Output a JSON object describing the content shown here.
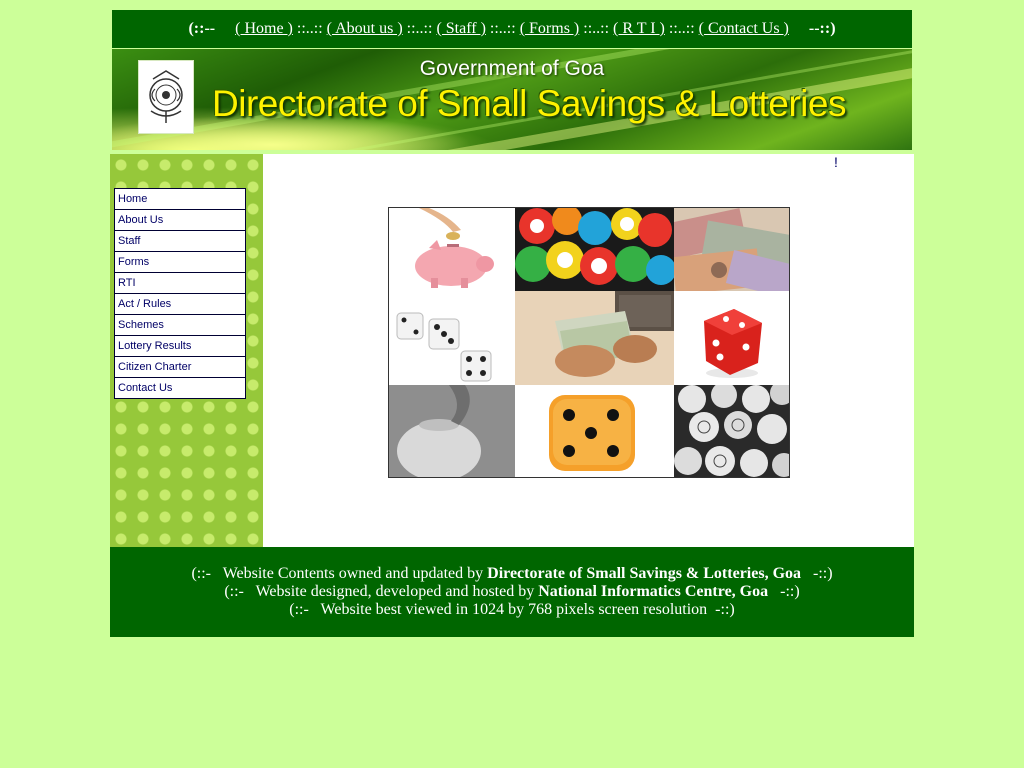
{
  "topnav": {
    "left_cap": "(::--",
    "right_cap": "--::)",
    "separator": " ::..:: ",
    "links": [
      {
        "label": "( Home )"
      },
      {
        "label": "( About us )"
      },
      {
        "label": "( Staff )"
      },
      {
        "label": "( Forms )"
      },
      {
        "label": "( R T I )"
      },
      {
        "label": "( Contact Us )"
      }
    ]
  },
  "banner": {
    "subtitle": "Government of Goa",
    "title": "Directorate of Small Savings & Lotteries",
    "emblem_icon": "goa-emblem-icon"
  },
  "sidebar": {
    "items": [
      {
        "label": "Home"
      },
      {
        "label": "About Us"
      },
      {
        "label": "Staff"
      },
      {
        "label": "Forms"
      },
      {
        "label": "RTI"
      },
      {
        "label": "Act / Rules"
      },
      {
        "label": "Schemes"
      },
      {
        "label": "Lottery Results"
      },
      {
        "label": "Citizen Charter"
      },
      {
        "label": "Contact Us"
      }
    ]
  },
  "main": {
    "marquee_text": "!",
    "collage_tiles": [
      "piggy-bank-icon",
      "lottery-balls-icon",
      "rupee-notes-icon",
      "white-dice-icon",
      "counting-money-icon",
      "red-die-icon",
      "savings-jar-icon",
      "orange-die-icon",
      "bingo-balls-icon"
    ]
  },
  "footer": {
    "line1_prefix": "(::-   Website Contents owned and updated by ",
    "line1_bold": "Directorate of Small Savings & Lotteries, Goa",
    "line1_suffix": "   -::)",
    "line2_prefix": "(::-   Website designed, developed and hosted by ",
    "line2_bold": "National Informatics Centre, Goa",
    "line2_suffix": "   -::)",
    "line3_prefix": "(::-   Website best viewed in 1024 by 768 pixels screen resolution",
    "line3_suffix": "  -::)"
  },
  "colors": {
    "page_bg": "#ccff99",
    "bar_green": "#006600",
    "banner_title": "#fff200",
    "menu_text": "#000066"
  }
}
